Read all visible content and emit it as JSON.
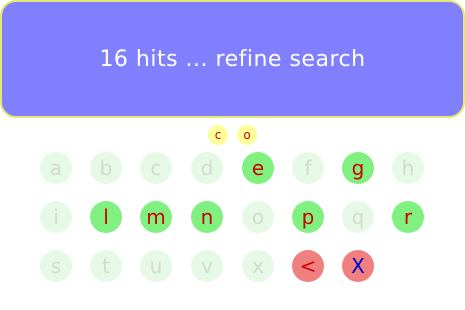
{
  "status": {
    "message": "16 hits ... refine search"
  },
  "typed": [
    "c",
    "o"
  ],
  "keyboard": {
    "rows": [
      [
        {
          "label": "a",
          "enabled": false
        },
        {
          "label": "b",
          "enabled": false
        },
        {
          "label": "c",
          "enabled": false
        },
        {
          "label": "d",
          "enabled": false
        },
        {
          "label": "e",
          "enabled": true
        },
        {
          "label": "f",
          "enabled": false
        },
        {
          "label": "g",
          "enabled": true
        },
        {
          "label": "h",
          "enabled": false
        }
      ],
      [
        {
          "label": "i",
          "enabled": false
        },
        {
          "label": "l",
          "enabled": true
        },
        {
          "label": "m",
          "enabled": true
        },
        {
          "label": "n",
          "enabled": true
        },
        {
          "label": "o",
          "enabled": false
        },
        {
          "label": "p",
          "enabled": true
        },
        {
          "label": "q",
          "enabled": false
        },
        {
          "label": "r",
          "enabled": true
        }
      ],
      [
        {
          "label": "s",
          "enabled": false
        },
        {
          "label": "t",
          "enabled": false
        },
        {
          "label": "u",
          "enabled": false
        },
        {
          "label": "v",
          "enabled": false
        },
        {
          "label": "x",
          "enabled": false
        }
      ]
    ],
    "backspace_label": "<",
    "clear_label": "X"
  },
  "colors": {
    "banner": "#8080ff",
    "banner_border": "#e6e676",
    "key_enabled": "#80f080",
    "key_disabled": "#e6f9e6",
    "key_action": "#f08080",
    "chip": "#ffff99"
  }
}
